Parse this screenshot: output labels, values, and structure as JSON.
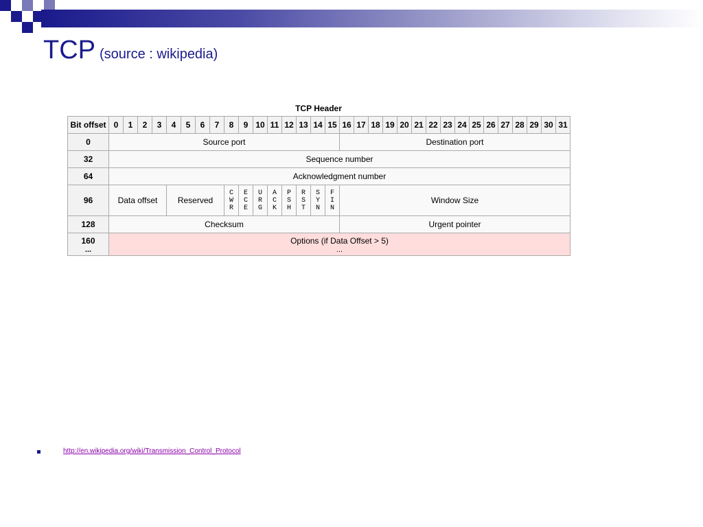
{
  "slide": {
    "title": "TCP",
    "subtitle": "(source : wikipedia)",
    "accent_color": "#1a1a8c"
  },
  "table": {
    "caption": "TCP Header",
    "bit_offset_label": "Bit offset",
    "bits": [
      "0",
      "1",
      "2",
      "3",
      "4",
      "5",
      "6",
      "7",
      "8",
      "9",
      "10",
      "11",
      "12",
      "13",
      "14",
      "15",
      "16",
      "17",
      "18",
      "19",
      "20",
      "21",
      "22",
      "23",
      "24",
      "25",
      "26",
      "27",
      "28",
      "29",
      "30",
      "31"
    ],
    "rows": {
      "r0": {
        "offset": "0",
        "source_port": "Source port",
        "destination_port": "Destination port"
      },
      "r32": {
        "offset": "32",
        "field": "Sequence number"
      },
      "r64": {
        "offset": "64",
        "field": "Acknowledgment number"
      },
      "r96": {
        "offset": "96",
        "data_offset": "Data offset",
        "reserved": "Reserved",
        "flags": [
          [
            "C",
            "W",
            "R"
          ],
          [
            "E",
            "C",
            "E"
          ],
          [
            "U",
            "R",
            "G"
          ],
          [
            "A",
            "C",
            "K"
          ],
          [
            "P",
            "S",
            "H"
          ],
          [
            "R",
            "S",
            "T"
          ],
          [
            "S",
            "Y",
            "N"
          ],
          [
            "F",
            "I",
            "N"
          ]
        ],
        "window_size": "Window Size"
      },
      "r128": {
        "offset": "128",
        "checksum": "Checksum",
        "urgent_pointer": "Urgent pointer"
      },
      "r160": {
        "offset": "160",
        "offset_cont": "...",
        "options": "Options (if Data Offset > 5)",
        "options_cont": "..."
      }
    },
    "options_color": "#ffdddd"
  },
  "footer": {
    "link": "http://en.wikipedia.org/wiki/Transmission_Control_Protocol"
  }
}
